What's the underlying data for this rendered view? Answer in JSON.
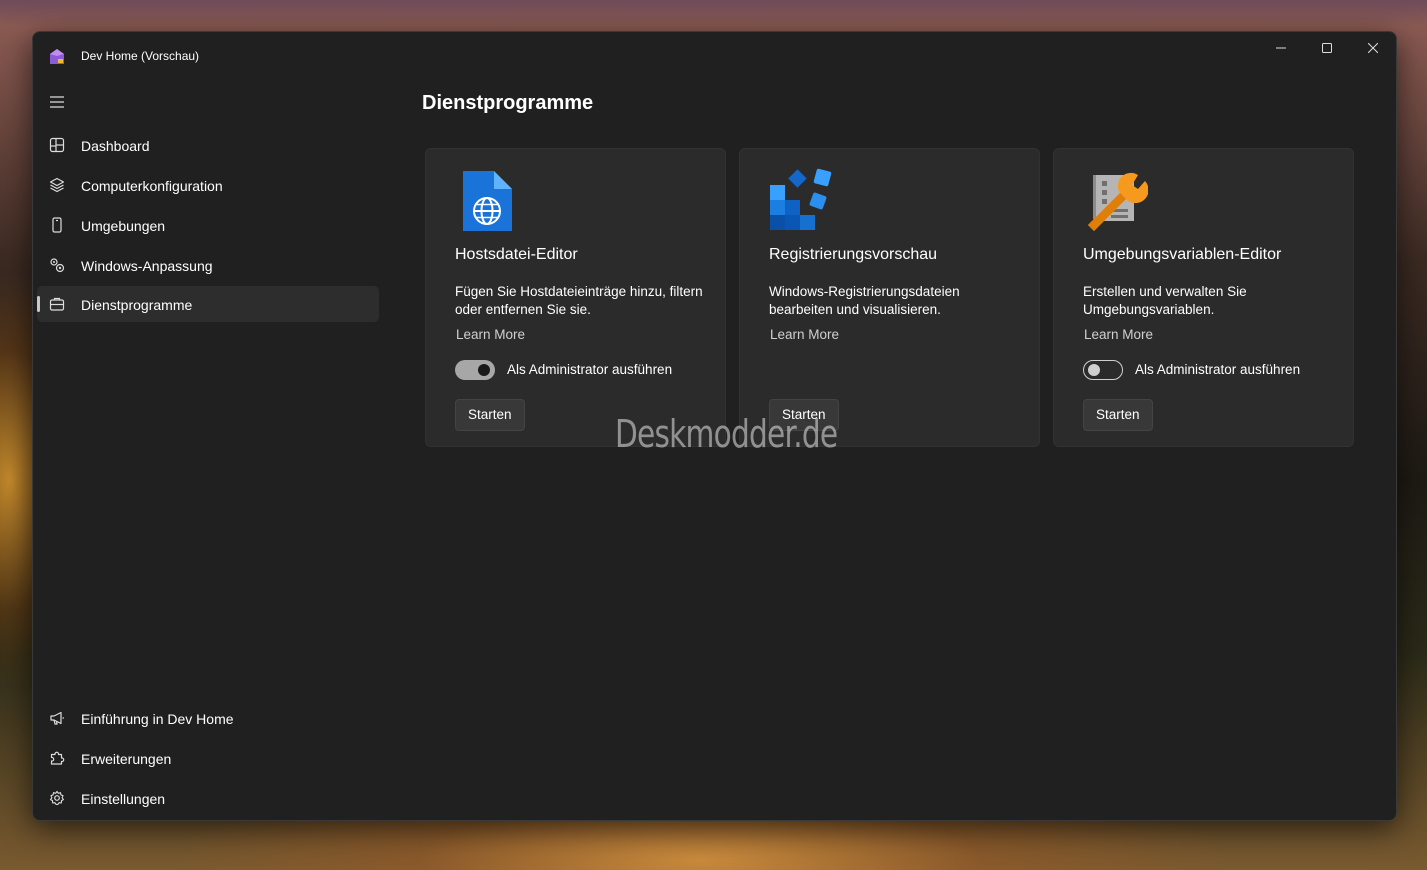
{
  "window": {
    "title": "Dev Home (Vorschau)"
  },
  "nav": {
    "items": [
      {
        "label": "Dashboard",
        "icon": "dashboard-icon"
      },
      {
        "label": "Computerkonfiguration",
        "icon": "layers-icon"
      },
      {
        "label": "Umgebungen",
        "icon": "device-icon"
      },
      {
        "label": "Windows-Anpassung",
        "icon": "customize-icon"
      },
      {
        "label": "Dienstprogramme",
        "icon": "toolbox-icon",
        "selected": true
      }
    ],
    "footer_items": [
      {
        "label": "Einführung in Dev Home",
        "icon": "megaphone-icon"
      },
      {
        "label": "Erweiterungen",
        "icon": "puzzle-icon"
      },
      {
        "label": "Einstellungen",
        "icon": "gear-icon"
      }
    ]
  },
  "page": {
    "title": "Dienstprogramme"
  },
  "utilities": [
    {
      "name": "Hostsdatei-Editor",
      "description": "Fügen Sie Hostdateieinträge hinzu, filtern oder entfernen Sie sie.",
      "link": "Learn More",
      "toggle_label": "Als Administrator ausführen",
      "toggle_on": true,
      "button": "Starten",
      "icon": "hosts-file-icon"
    },
    {
      "name": "Registrierungsvorschau",
      "description": "Windows-Registrierungsdateien bearbeiten und visualisieren.",
      "link": "Learn More",
      "button": "Starten",
      "icon": "registry-preview-icon"
    },
    {
      "name": "Umgebungsvariablen-Editor",
      "description": "Erstellen und verwalten Sie Umgebungsvariablen.",
      "link": "Learn More",
      "toggle_label": "Als Administrator ausführen",
      "toggle_on": false,
      "button": "Starten",
      "icon": "env-variables-icon"
    }
  ],
  "watermark": "Deskmodder.de",
  "colors": {
    "window_bg": "#202020",
    "card_bg": "#2b2b2b",
    "selected_nav_bg": "#2d2d2d"
  }
}
